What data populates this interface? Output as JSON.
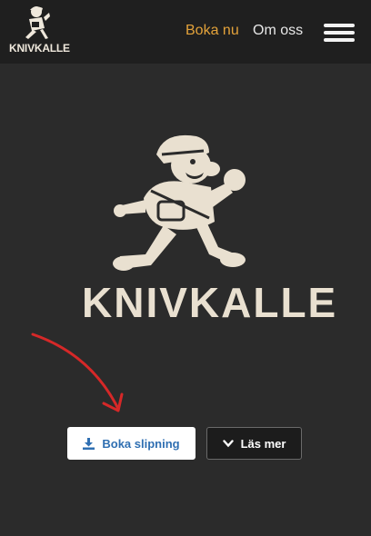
{
  "header": {
    "brand_name": "KNIVKALLE",
    "nav": [
      {
        "label": "Boka nu",
        "color": "#e3a23a"
      },
      {
        "label": "Om oss",
        "color": "#e8e8e8"
      }
    ],
    "menu_icon": "hamburger-menu-icon"
  },
  "hero": {
    "logo_icon": "running-mascot-icon",
    "title": "KNIVKALLE",
    "arrow_icon": "red-arrow-icon"
  },
  "actions": {
    "primary": {
      "label": "Boka slipning",
      "icon": "download-icon"
    },
    "secondary": {
      "label": "Läs mer",
      "icon": "chevron-down-icon"
    }
  },
  "colors": {
    "background": "#2b2b2b",
    "header": "#1f1f1f",
    "accent": "#e3a23a",
    "mascot": "#e9e0d0",
    "arrow": "#d62828",
    "primary_button_text": "#2f6fb2"
  }
}
